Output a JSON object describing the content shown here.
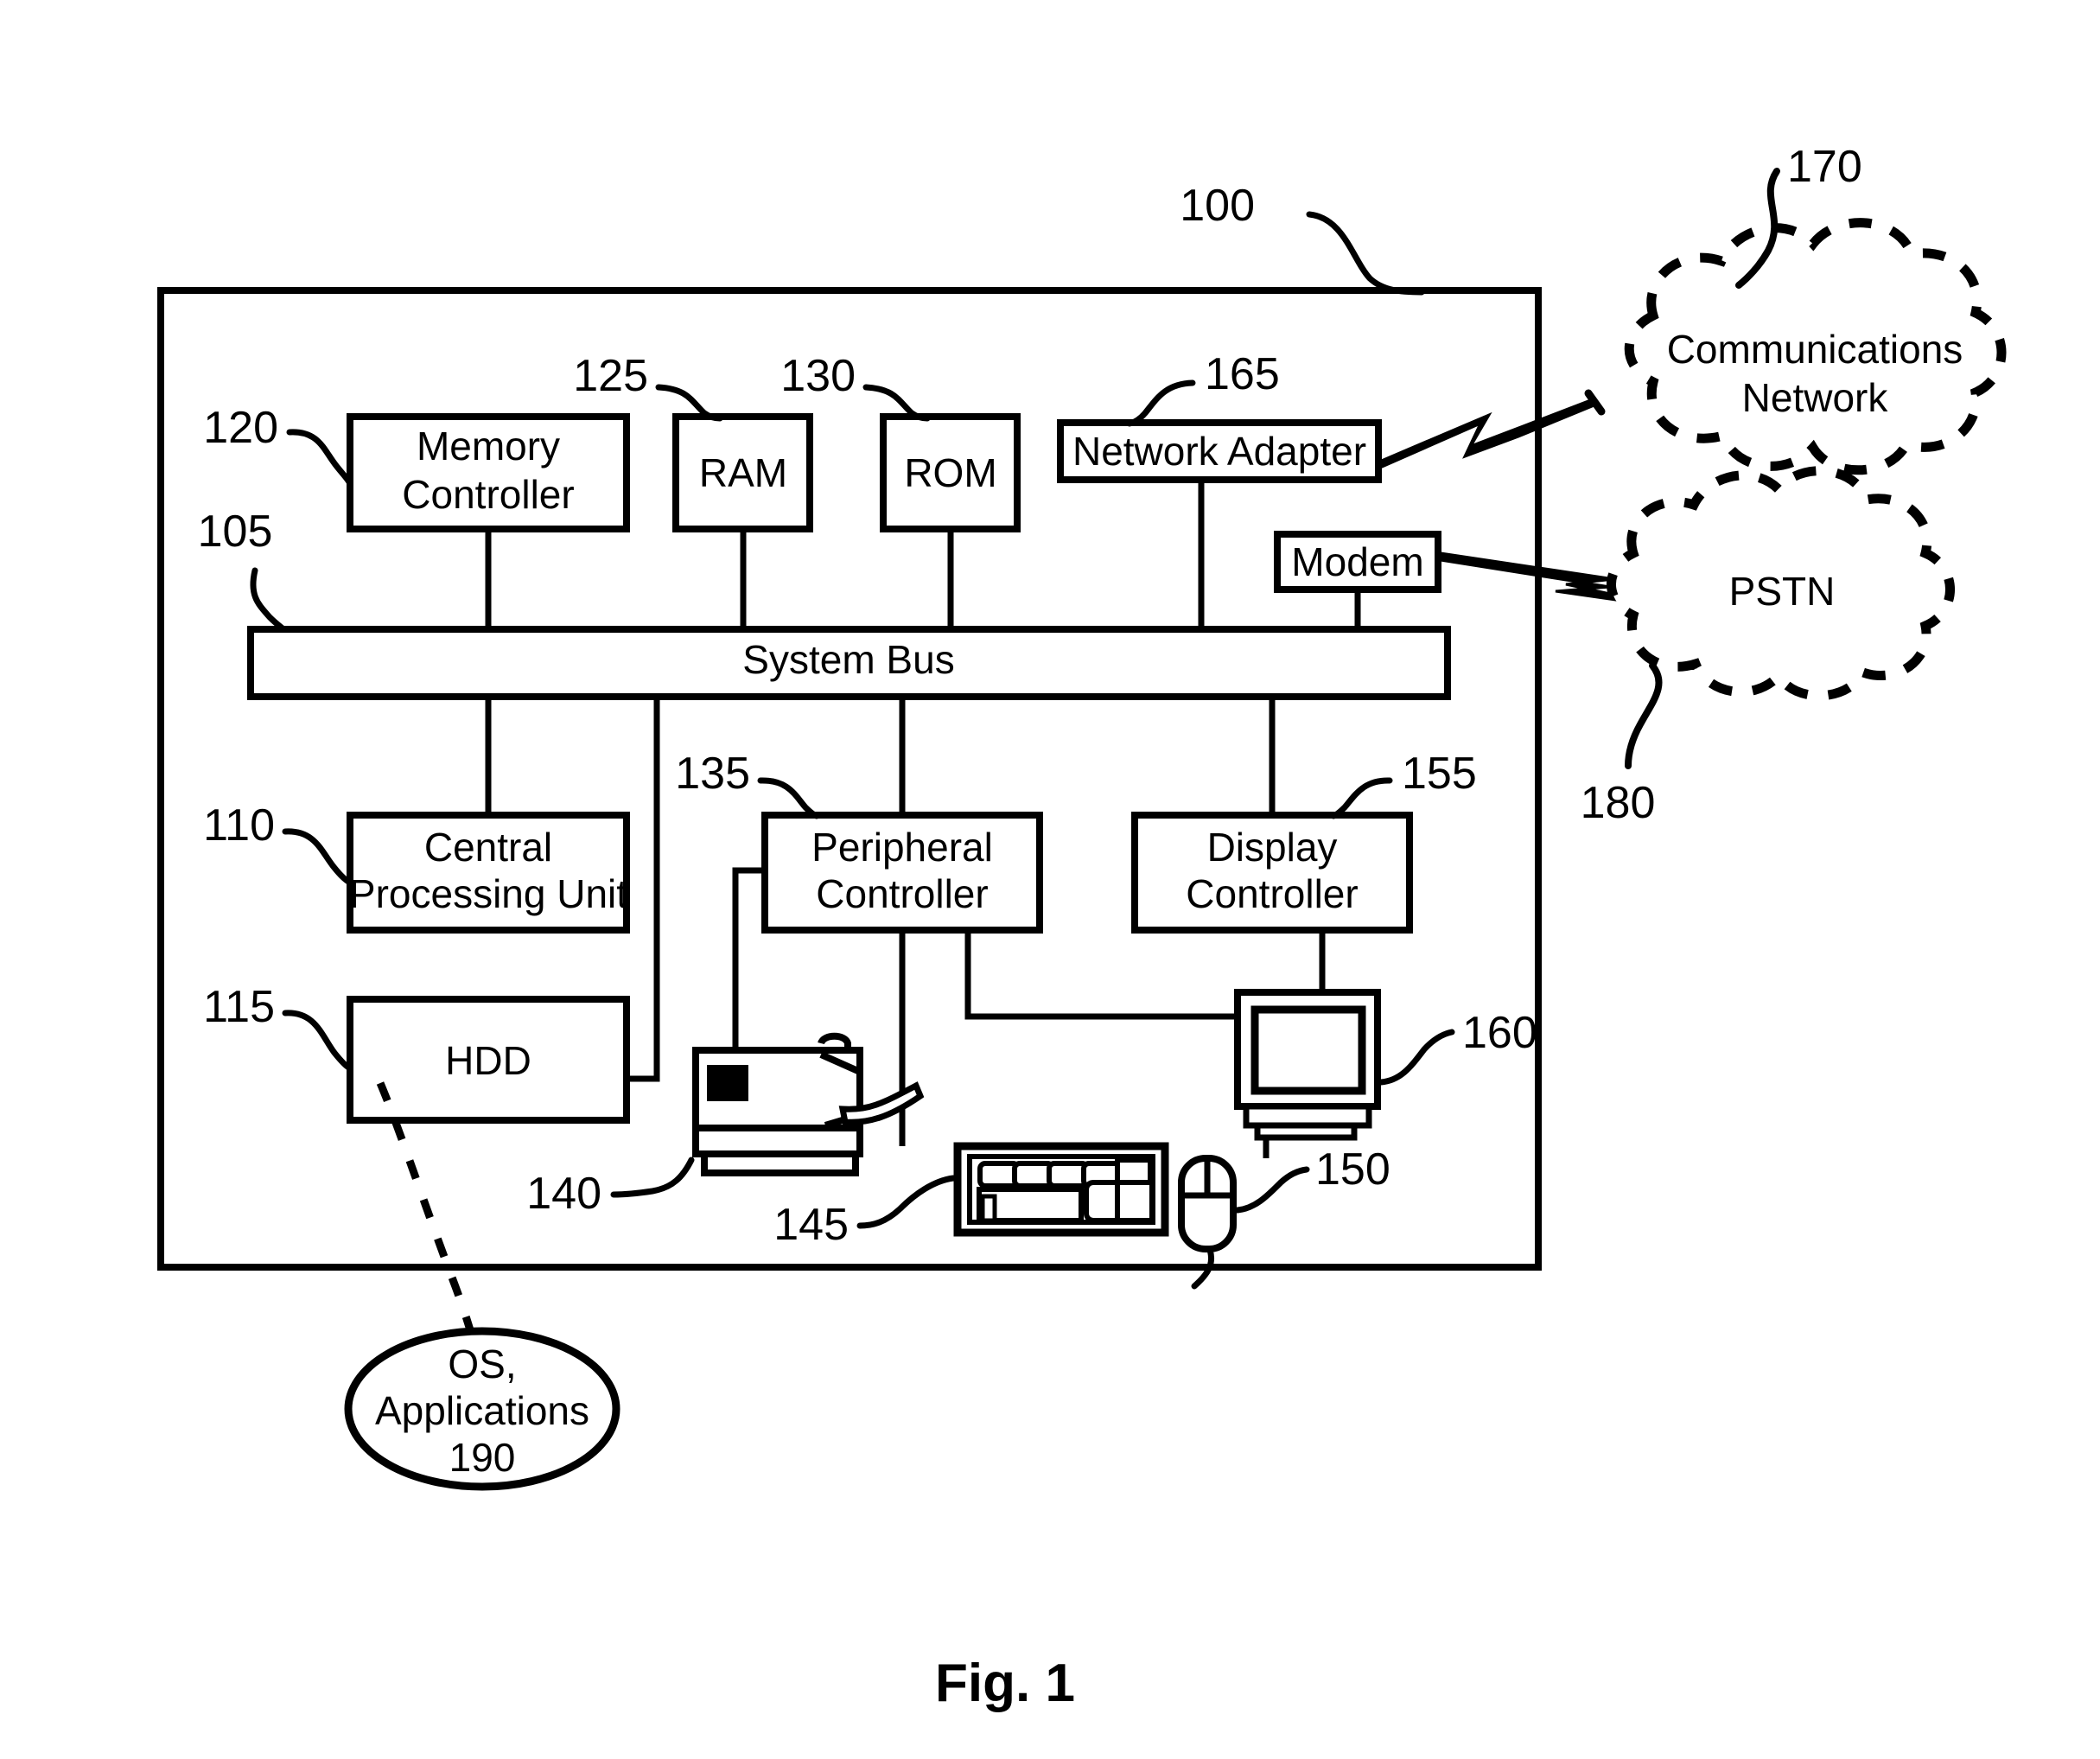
{
  "figure": {
    "caption": "Fig. 1",
    "system_ref": "100"
  },
  "blocks": {
    "memory_controller": {
      "label_line1": "Memory",
      "label_line2": "Controller",
      "ref": "120"
    },
    "ram": {
      "label": "RAM",
      "ref": "125"
    },
    "rom": {
      "label": "ROM",
      "ref": "130"
    },
    "network_adapter": {
      "label": "Network Adapter",
      "ref": "165"
    },
    "modem": {
      "label": "Modem",
      "ref": ""
    },
    "system_bus": {
      "label": "System Bus",
      "ref": "105"
    },
    "cpu": {
      "label_line1": "Central",
      "label_line2": "Processing Unit",
      "ref": "110"
    },
    "hdd": {
      "label": "HDD",
      "ref": "115"
    },
    "peripheral_controller": {
      "label_line1": "Peripheral",
      "label_line2": "Controller",
      "ref": "135"
    },
    "display_controller": {
      "label_line1": "Display",
      "label_line2": "Controller",
      "ref": "155"
    }
  },
  "clouds": {
    "communications_network": {
      "label_line1": "Communications",
      "label_line2": "Network",
      "ref": "170"
    },
    "pstn": {
      "label": "PSTN",
      "ref": "180"
    }
  },
  "ellipse": {
    "os_applications": {
      "label_line1": "OS,",
      "label_line2": "Applications",
      "label_line3": "190"
    }
  },
  "peripherals": {
    "printer": {
      "ref": "140"
    },
    "keyboard": {
      "ref": "145"
    },
    "mouse": {
      "ref": "150"
    },
    "monitor": {
      "ref": "160"
    }
  },
  "colors": {
    "stroke": "#000000",
    "background": "#ffffff"
  }
}
